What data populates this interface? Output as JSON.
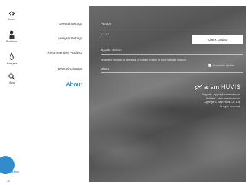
{
  "rail": {
    "items": [
      {
        "label": "Home",
        "icon": "home-icon"
      },
      {
        "label": "Customer",
        "icon": "person-icon"
      },
      {
        "label": "Analysis",
        "icon": "analysis-icon"
      },
      {
        "label": "View",
        "icon": "search-icon"
      }
    ],
    "bottom_label": "Setting"
  },
  "menu": {
    "items": [
      {
        "label": "General Settings"
      },
      {
        "label": "Analysis Settings"
      },
      {
        "label": "Recommended Products"
      },
      {
        "label": "Device Activation"
      }
    ],
    "active": "About"
  },
  "content": {
    "version_title": "Version",
    "version_value": "v 1.0.7",
    "check_update_label": "Check Update",
    "update_title": "Update Option",
    "update_desc": "When the program is operated, the latest version is automatically installed.",
    "auto_update_label": "Automatic Update",
    "auto_update_checked": false,
    "about_title": "About",
    "logo_text": "aram HUVIS",
    "about_lines": [
      "Support : support@aramhuvis.com",
      "Website : www.aramhuvis.com",
      "Copyright © Aram Huvis Co., Ltd.",
      "All rights reserved."
    ]
  },
  "colors": {
    "accent": "#1a7fc4",
    "button_bg": "#ffffff"
  }
}
